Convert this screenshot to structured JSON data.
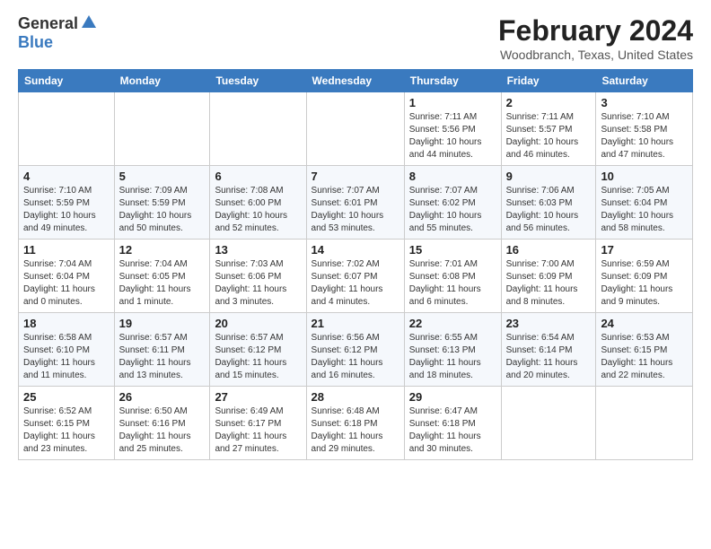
{
  "header": {
    "logo_general": "General",
    "logo_blue": "Blue",
    "title": "February 2024",
    "subtitle": "Woodbranch, Texas, United States"
  },
  "weekdays": [
    "Sunday",
    "Monday",
    "Tuesday",
    "Wednesday",
    "Thursday",
    "Friday",
    "Saturday"
  ],
  "weeks": [
    [
      {
        "day": "",
        "empty": true
      },
      {
        "day": "",
        "empty": true
      },
      {
        "day": "",
        "empty": true
      },
      {
        "day": "",
        "empty": true
      },
      {
        "day": "1",
        "sunrise": "Sunrise: 7:11 AM",
        "sunset": "Sunset: 5:56 PM",
        "daylight": "Daylight: 10 hours and 44 minutes."
      },
      {
        "day": "2",
        "sunrise": "Sunrise: 7:11 AM",
        "sunset": "Sunset: 5:57 PM",
        "daylight": "Daylight: 10 hours and 46 minutes."
      },
      {
        "day": "3",
        "sunrise": "Sunrise: 7:10 AM",
        "sunset": "Sunset: 5:58 PM",
        "daylight": "Daylight: 10 hours and 47 minutes."
      }
    ],
    [
      {
        "day": "4",
        "sunrise": "Sunrise: 7:10 AM",
        "sunset": "Sunset: 5:59 PM",
        "daylight": "Daylight: 10 hours and 49 minutes."
      },
      {
        "day": "5",
        "sunrise": "Sunrise: 7:09 AM",
        "sunset": "Sunset: 5:59 PM",
        "daylight": "Daylight: 10 hours and 50 minutes."
      },
      {
        "day": "6",
        "sunrise": "Sunrise: 7:08 AM",
        "sunset": "Sunset: 6:00 PM",
        "daylight": "Daylight: 10 hours and 52 minutes."
      },
      {
        "day": "7",
        "sunrise": "Sunrise: 7:07 AM",
        "sunset": "Sunset: 6:01 PM",
        "daylight": "Daylight: 10 hours and 53 minutes."
      },
      {
        "day": "8",
        "sunrise": "Sunrise: 7:07 AM",
        "sunset": "Sunset: 6:02 PM",
        "daylight": "Daylight: 10 hours and 55 minutes."
      },
      {
        "day": "9",
        "sunrise": "Sunrise: 7:06 AM",
        "sunset": "Sunset: 6:03 PM",
        "daylight": "Daylight: 10 hours and 56 minutes."
      },
      {
        "day": "10",
        "sunrise": "Sunrise: 7:05 AM",
        "sunset": "Sunset: 6:04 PM",
        "daylight": "Daylight: 10 hours and 58 minutes."
      }
    ],
    [
      {
        "day": "11",
        "sunrise": "Sunrise: 7:04 AM",
        "sunset": "Sunset: 6:04 PM",
        "daylight": "Daylight: 11 hours and 0 minutes."
      },
      {
        "day": "12",
        "sunrise": "Sunrise: 7:04 AM",
        "sunset": "Sunset: 6:05 PM",
        "daylight": "Daylight: 11 hours and 1 minute."
      },
      {
        "day": "13",
        "sunrise": "Sunrise: 7:03 AM",
        "sunset": "Sunset: 6:06 PM",
        "daylight": "Daylight: 11 hours and 3 minutes."
      },
      {
        "day": "14",
        "sunrise": "Sunrise: 7:02 AM",
        "sunset": "Sunset: 6:07 PM",
        "daylight": "Daylight: 11 hours and 4 minutes."
      },
      {
        "day": "15",
        "sunrise": "Sunrise: 7:01 AM",
        "sunset": "Sunset: 6:08 PM",
        "daylight": "Daylight: 11 hours and 6 minutes."
      },
      {
        "day": "16",
        "sunrise": "Sunrise: 7:00 AM",
        "sunset": "Sunset: 6:09 PM",
        "daylight": "Daylight: 11 hours and 8 minutes."
      },
      {
        "day": "17",
        "sunrise": "Sunrise: 6:59 AM",
        "sunset": "Sunset: 6:09 PM",
        "daylight": "Daylight: 11 hours and 9 minutes."
      }
    ],
    [
      {
        "day": "18",
        "sunrise": "Sunrise: 6:58 AM",
        "sunset": "Sunset: 6:10 PM",
        "daylight": "Daylight: 11 hours and 11 minutes."
      },
      {
        "day": "19",
        "sunrise": "Sunrise: 6:57 AM",
        "sunset": "Sunset: 6:11 PM",
        "daylight": "Daylight: 11 hours and 13 minutes."
      },
      {
        "day": "20",
        "sunrise": "Sunrise: 6:57 AM",
        "sunset": "Sunset: 6:12 PM",
        "daylight": "Daylight: 11 hours and 15 minutes."
      },
      {
        "day": "21",
        "sunrise": "Sunrise: 6:56 AM",
        "sunset": "Sunset: 6:12 PM",
        "daylight": "Daylight: 11 hours and 16 minutes."
      },
      {
        "day": "22",
        "sunrise": "Sunrise: 6:55 AM",
        "sunset": "Sunset: 6:13 PM",
        "daylight": "Daylight: 11 hours and 18 minutes."
      },
      {
        "day": "23",
        "sunrise": "Sunrise: 6:54 AM",
        "sunset": "Sunset: 6:14 PM",
        "daylight": "Daylight: 11 hours and 20 minutes."
      },
      {
        "day": "24",
        "sunrise": "Sunrise: 6:53 AM",
        "sunset": "Sunset: 6:15 PM",
        "daylight": "Daylight: 11 hours and 22 minutes."
      }
    ],
    [
      {
        "day": "25",
        "sunrise": "Sunrise: 6:52 AM",
        "sunset": "Sunset: 6:15 PM",
        "daylight": "Daylight: 11 hours and 23 minutes."
      },
      {
        "day": "26",
        "sunrise": "Sunrise: 6:50 AM",
        "sunset": "Sunset: 6:16 PM",
        "daylight": "Daylight: 11 hours and 25 minutes."
      },
      {
        "day": "27",
        "sunrise": "Sunrise: 6:49 AM",
        "sunset": "Sunset: 6:17 PM",
        "daylight": "Daylight: 11 hours and 27 minutes."
      },
      {
        "day": "28",
        "sunrise": "Sunrise: 6:48 AM",
        "sunset": "Sunset: 6:18 PM",
        "daylight": "Daylight: 11 hours and 29 minutes."
      },
      {
        "day": "29",
        "sunrise": "Sunrise: 6:47 AM",
        "sunset": "Sunset: 6:18 PM",
        "daylight": "Daylight: 11 hours and 30 minutes."
      },
      {
        "day": "",
        "empty": true
      },
      {
        "day": "",
        "empty": true
      }
    ]
  ]
}
